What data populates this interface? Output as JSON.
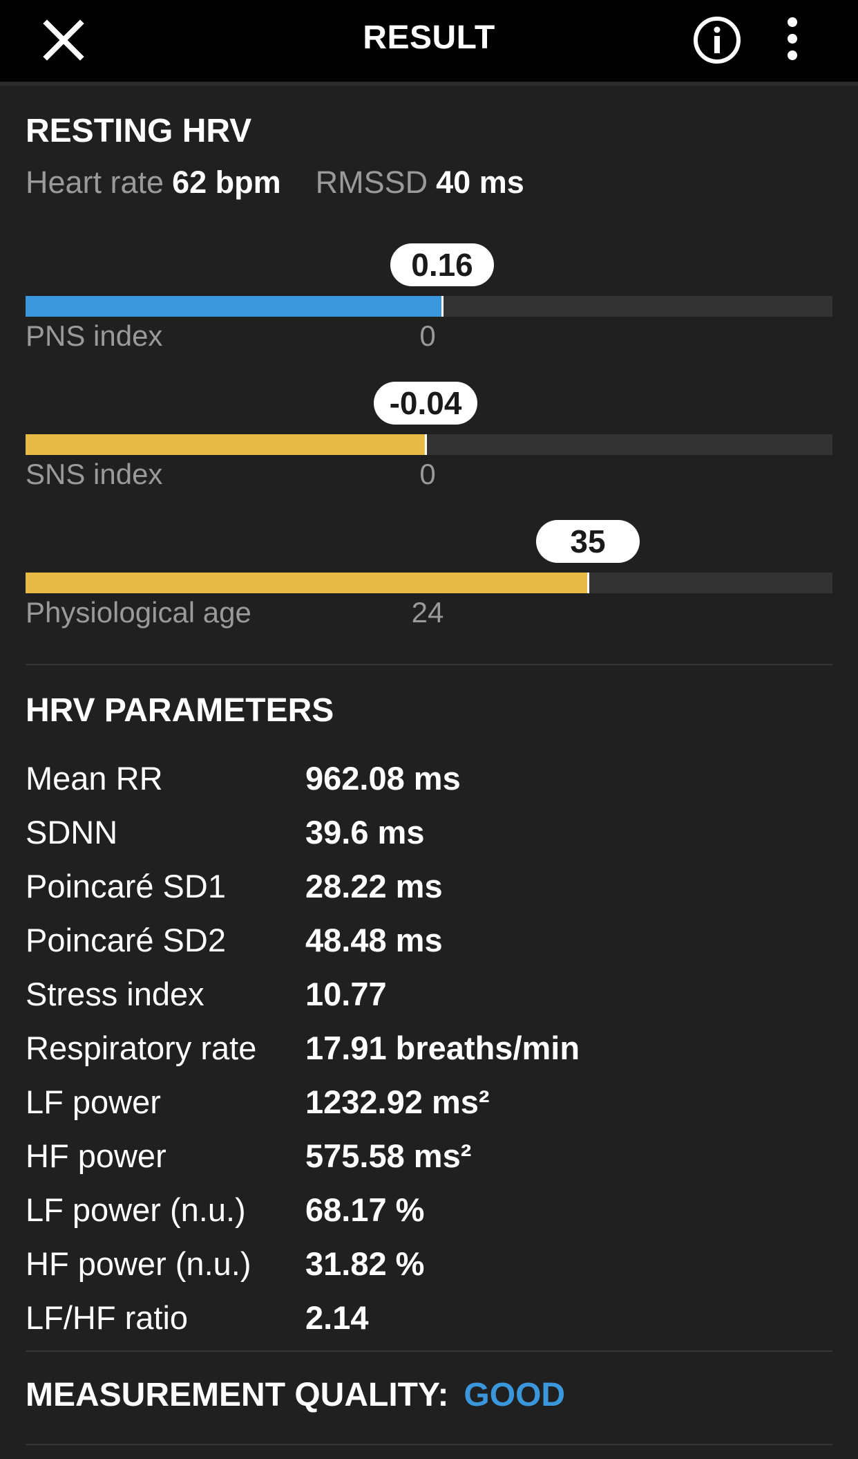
{
  "header": {
    "title": "RESULT",
    "close_icon": "close-icon",
    "info_icon": "info-circle-icon",
    "more_icon": "more-vert-icon"
  },
  "resting_hrv": {
    "title": "RESTING HRV",
    "heart_rate_label": "Heart rate",
    "heart_rate_value": "62 bpm",
    "rmssd_label": "RMSSD",
    "rmssd_value": "40 ms"
  },
  "indices": [
    {
      "label": "PNS index",
      "value_text": "0.16",
      "baseline": "0",
      "fill_fraction": 0.516,
      "color": "#3b97dc"
    },
    {
      "label": "SNS index",
      "value_text": "-0.04",
      "baseline": "0",
      "fill_fraction": 0.496,
      "color": "#e5bb45"
    },
    {
      "label": "Physiological age",
      "value_text": "35",
      "baseline": "24",
      "fill_fraction": 0.697,
      "color": "#e5bb45"
    }
  ],
  "hrv_parameters": {
    "title": "HRV PARAMETERS",
    "rows": [
      {
        "name": "Mean RR",
        "value": "962.08 ms"
      },
      {
        "name": "SDNN",
        "value": "39.6 ms"
      },
      {
        "name": "Poincaré SD1",
        "value": "28.22 ms"
      },
      {
        "name": "Poincaré SD2",
        "value": "48.48 ms"
      },
      {
        "name": "Stress index",
        "value": "10.77"
      },
      {
        "name": "Respiratory rate",
        "value": "17.91 breaths/min"
      },
      {
        "name": "LF power",
        "value": "1232.92 ms²"
      },
      {
        "name": "HF power",
        "value": "575.58 ms²"
      },
      {
        "name": "LF power (n.u.)",
        "value": "68.17 %"
      },
      {
        "name": "HF power (n.u.)",
        "value": "31.82 %"
      },
      {
        "name": "LF/HF ratio",
        "value": "2.14"
      }
    ]
  },
  "measurement_quality": {
    "label": "MEASUREMENT QUALITY:",
    "value": "GOOD",
    "value_color": "#3b97dc"
  }
}
